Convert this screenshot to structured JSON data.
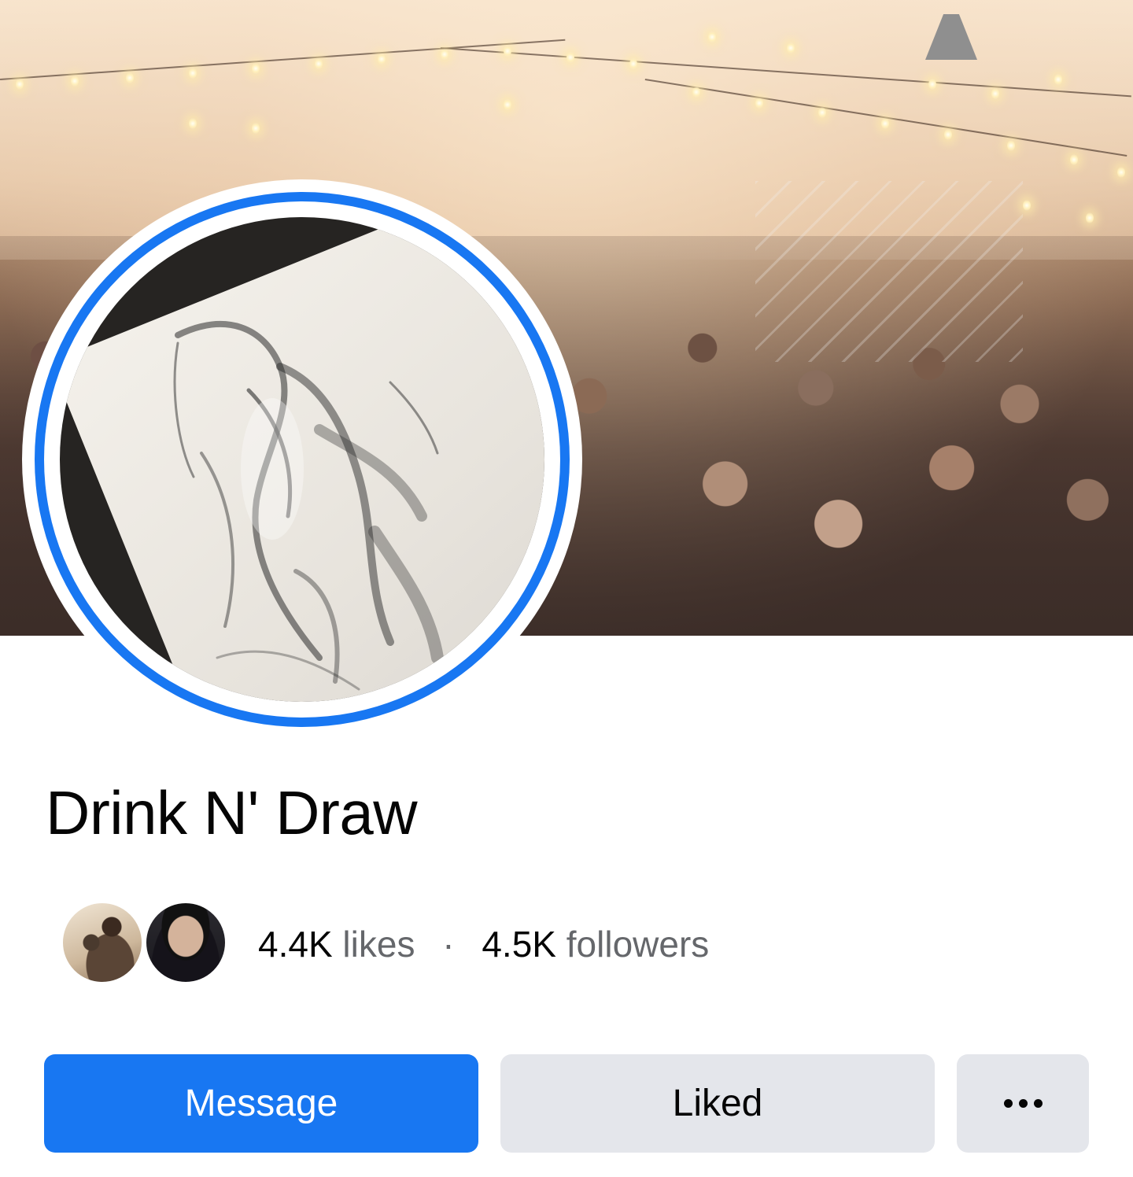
{
  "page": {
    "title": "Drink N' Draw"
  },
  "stats": {
    "likes_count": "4.4K",
    "likes_label": "likes",
    "separator": "·",
    "followers_count": "4.5K",
    "followers_label": "followers"
  },
  "actions": {
    "message_label": "Message",
    "liked_label": "Liked",
    "more_icon": "more-horizontal-icon"
  },
  "colors": {
    "accent": "#1877f2",
    "secondary_button": "#e4e6eb",
    "text_primary": "#050505",
    "text_secondary": "#65676b"
  }
}
